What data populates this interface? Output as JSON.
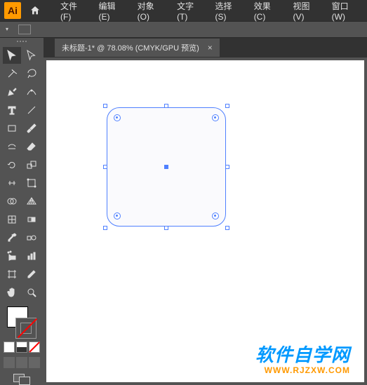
{
  "app": {
    "logo": "Ai"
  },
  "menu": {
    "file": "文件(F)",
    "edit": "编辑(E)",
    "object": "对象(O)",
    "type": "文字(T)",
    "select": "选择(S)",
    "effect": "效果(C)",
    "view": "视图(V)",
    "window": "窗口(W)"
  },
  "document": {
    "tab_label": "未标题-1* @ 78.08% (CMYK/GPU 预览)",
    "close": "×"
  },
  "watermark": {
    "title": "软件自学网",
    "url": "WWW.RJZXW.COM"
  },
  "colors": {
    "accent": "#4f80ff",
    "toolbar_bg": "#535353",
    "app_bg": "#323232",
    "ai_orange": "#ff9a00"
  }
}
